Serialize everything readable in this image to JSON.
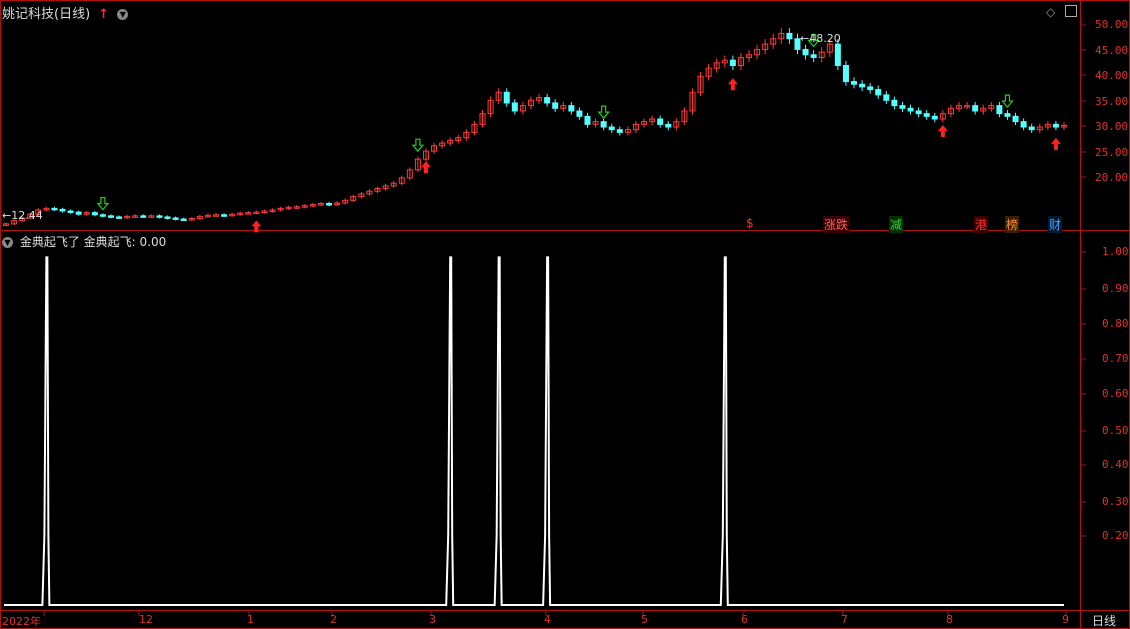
{
  "header": {
    "stock_title": "姚记科技(日线)",
    "indicator_title": "金典起飞了 金典起飞: 0.00"
  },
  "price_axis": [
    "50.00",
    "45.00",
    "40.00",
    "35.00",
    "30.00",
    "25.00",
    "20.00"
  ],
  "indicator_axis": [
    "1.00",
    "0.90",
    "0.80",
    "0.70",
    "0.60",
    "0.50",
    "0.40",
    "0.30",
    "0.20"
  ],
  "x_axis": [
    "2022年",
    "12",
    "1",
    "2",
    "3",
    "4",
    "5",
    "6",
    "7",
    "8",
    "9"
  ],
  "period_label": "日线",
  "price_low_label": "12.44",
  "price_high_label": "48.20",
  "event_markers": [
    {
      "text": "$",
      "color": "#ff3030"
    },
    {
      "text": "涨跌",
      "color": "#ff6060"
    },
    {
      "text": "减",
      "color": "#30d030"
    },
    {
      "text": "港",
      "color": "#ff3030"
    },
    {
      "text": "榜",
      "color": "#ff9030"
    },
    {
      "text": "财",
      "color": "#50a0ff"
    }
  ],
  "colors": {
    "up": "#ff3b3b",
    "down": "#54ffff",
    "axis": "#b01010",
    "signal_buy": "#ff2020",
    "signal_sell": "#20d020",
    "indicator_line": "#ffffff"
  },
  "chart_data": {
    "type": "candlestick",
    "price_ylim": [
      12,
      52
    ],
    "close_approx": [
      12.4,
      13.0,
      13.5,
      14.2,
      15.0,
      15.3,
      15.1,
      14.8,
      14.6,
      14.2,
      14.5,
      14.1,
      13.9,
      13.7,
      13.6,
      13.8,
      13.9,
      13.8,
      13.9,
      13.7,
      13.5,
      13.3,
      13.2,
      13.4,
      13.8,
      14.0,
      14.1,
      14.0,
      14.2,
      14.4,
      14.5,
      14.6,
      14.8,
      15.0,
      15.3,
      15.5,
      15.6,
      15.8,
      16.0,
      16.2,
      16.0,
      16.3,
      16.8,
      17.5,
      18.0,
      18.5,
      19.0,
      19.5,
      20.0,
      21.0,
      22.5,
      24.5,
      26.0,
      27.0,
      27.5,
      28.0,
      28.5,
      29.5,
      31.0,
      33.0,
      35.5,
      37.0,
      35.0,
      33.5,
      34.5,
      35.5,
      36.0,
      35.0,
      34.0,
      34.5,
      33.5,
      32.5,
      31.0,
      31.5,
      30.5,
      30.0,
      29.5,
      30.0,
      31.0,
      31.5,
      32.0,
      31.0,
      30.5,
      31.5,
      33.5,
      37.0,
      40.0,
      41.5,
      42.5,
      43.0,
      42.0,
      43.5,
      44.0,
      45.0,
      46.0,
      47.0,
      48.0,
      47.0,
      45.0,
      44.0,
      43.5,
      44.5,
      46.0,
      42.0,
      39.0,
      38.5,
      38.0,
      37.5,
      36.5,
      35.5,
      34.5,
      34.0,
      33.5,
      33.0,
      32.5,
      32.0,
      33.0,
      34.0,
      34.5,
      34.5,
      33.5,
      34.0,
      34.5,
      33.0,
      32.5,
      31.5,
      30.5,
      30.0,
      30.5,
      31.0,
      30.5,
      30.8
    ],
    "indicator_name": "金典起飞",
    "indicator_ylim": [
      0,
      1.05
    ],
    "indicator_spikes_x_index": [
      5,
      55,
      61,
      67,
      89
    ],
    "buy_signals_x_index": [
      31,
      52,
      90,
      116,
      130
    ],
    "sell_signals_x_index": [
      12,
      51,
      74,
      100,
      124
    ]
  }
}
